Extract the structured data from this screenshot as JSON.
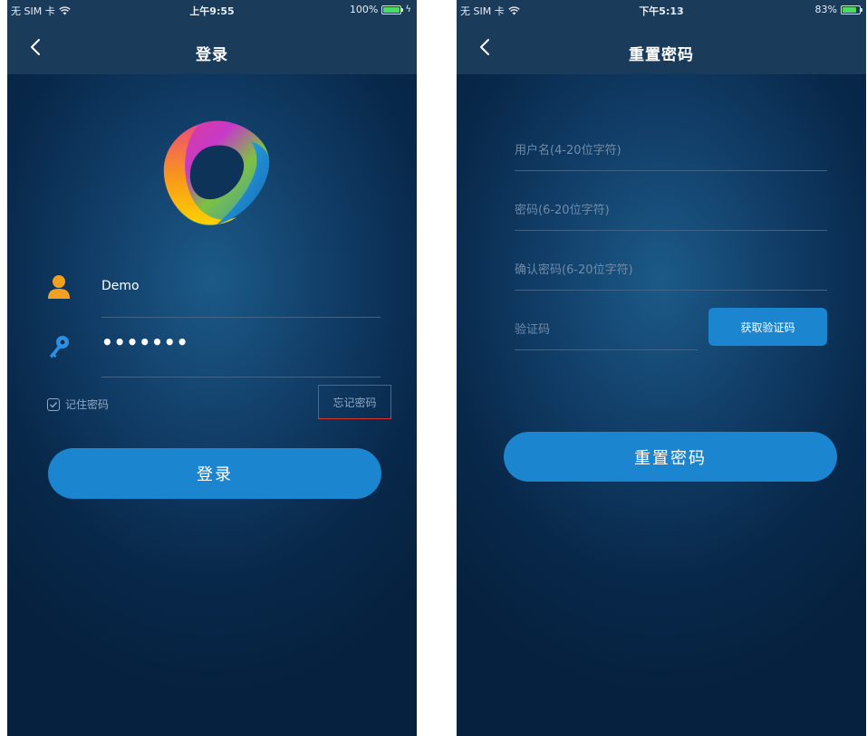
{
  "login_screen": {
    "status_bar": {
      "carrier": "无 SIM 卡",
      "time": "上午9:55",
      "battery_percent": "100%",
      "battery_level": 1.0
    },
    "nav": {
      "title": "登录",
      "back_icon": "chevron-left-icon"
    },
    "logo_icon": "app-logo-icon",
    "username": {
      "icon": "user-icon",
      "value": "Demo"
    },
    "password": {
      "icon": "key-icon",
      "masked_value": "•••••••"
    },
    "remember_label": "记住密码",
    "remember_checked": true,
    "forgot_label": "忘记密码",
    "login_label": "登录"
  },
  "reset_screen": {
    "status_bar": {
      "carrier": "无 SIM 卡",
      "time": "下午5:13",
      "battery_percent": "83%",
      "battery_level": 0.83
    },
    "nav": {
      "title": "重置密码",
      "back_icon": "chevron-left-icon"
    },
    "username_placeholder": "用户名(4-20位字符)",
    "password_placeholder": "密码(6-20位字符)",
    "confirm_placeholder": "确认密码(6-20位字符)",
    "code_placeholder": "验证码",
    "get_code_label": "获取验证码",
    "reset_label": "重置密码"
  },
  "colors": {
    "background": "#0b2d52",
    "nav_bar": "#1a3b5a",
    "button_blue": "#1b86cf",
    "user_icon": "#f2a021",
    "key_icon": "#2f8fe0",
    "highlight_box": "#d9342b",
    "battery_green": "#4cd964"
  }
}
